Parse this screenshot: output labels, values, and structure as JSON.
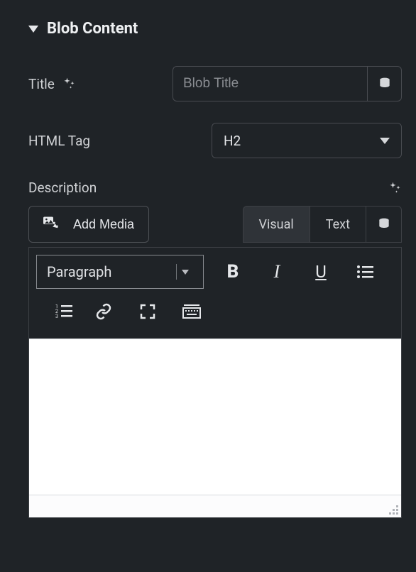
{
  "section": {
    "title": "Blob Content"
  },
  "title_field": {
    "label": "Title",
    "placeholder": "Blob Title",
    "value": ""
  },
  "htmltag_field": {
    "label": "HTML Tag",
    "value": "H2"
  },
  "description_field": {
    "label": "Description"
  },
  "add_media": {
    "label": "Add Media"
  },
  "editor_tabs": {
    "visual": "Visual",
    "text": "Text"
  },
  "format_select": {
    "value": "Paragraph"
  }
}
